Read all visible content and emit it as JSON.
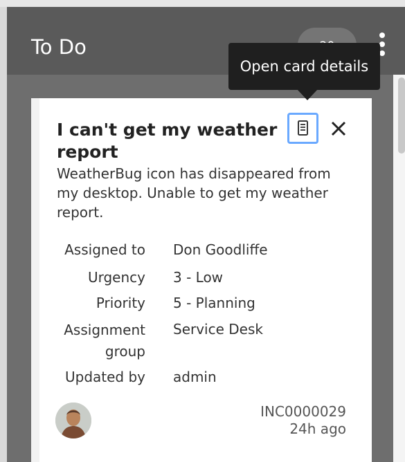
{
  "column": {
    "title": "To Do",
    "count": "20",
    "more_options_icon": "kebab-vertical-icon"
  },
  "tooltip": {
    "text": "Open card details"
  },
  "card": {
    "title": "I can't get my weather report",
    "description": "WeatherBug icon has disappeared from my desktop. Unable to get my weather report.",
    "open_details_icon": "document-icon",
    "close_icon": "close-icon",
    "fields": [
      {
        "label": "Assigned to",
        "value": "Don Goodliffe"
      },
      {
        "label": "Urgency",
        "value": "3 - Low"
      },
      {
        "label": "Priority",
        "value": "5 - Planning"
      },
      {
        "label": "Assignment group",
        "value": "Service Desk"
      },
      {
        "label": "Updated by",
        "value": "admin"
      }
    ],
    "number": "INC0000029",
    "updated_ago": "24h ago"
  },
  "colors": {
    "column_header": "#5a5a5a",
    "column_body": "#6e6e6e",
    "focus_ring": "#6aa9ff",
    "tooltip": "#1f1f1f"
  }
}
